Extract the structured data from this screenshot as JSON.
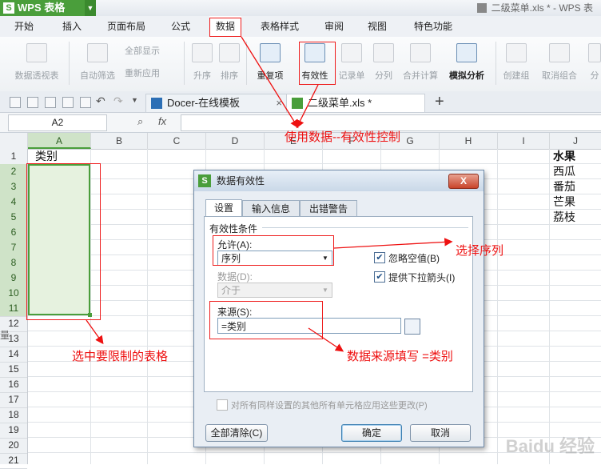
{
  "app": {
    "name": "WPS 表格",
    "logo_letter": "S",
    "document_title": "二级菜单.xls * - WPS 表"
  },
  "menu": [
    "开始",
    "插入",
    "页面布局",
    "公式",
    "数据",
    "表格样式",
    "审阅",
    "视图",
    "特色功能"
  ],
  "ribbon": {
    "pivot": "数据透视表",
    "autofilter": "自动筛选",
    "show_all": "全部显示",
    "reapply": "重新应用",
    "sort_asc": "升序",
    "sort_desc": "排序",
    "duplicates": "重复项",
    "validation": "有效性",
    "record": "记录单",
    "split": "分列",
    "consolidate": "合并计算",
    "what_if": "模拟分析",
    "group": "创建组",
    "ungroup": "取消组合",
    "more": "分"
  },
  "tabs": [
    {
      "label": "Docer-在线模板",
      "active": false
    },
    {
      "label": "二级菜单.xls *",
      "active": true
    }
  ],
  "formula_bar": {
    "name_box": "A2",
    "fx": "fx"
  },
  "grid": {
    "columns": [
      "A",
      "B",
      "C",
      "D",
      "E",
      "F",
      "G",
      "H",
      "I",
      "J"
    ],
    "rows": [
      "1",
      "2",
      "3",
      "4",
      "5",
      "6",
      "7",
      "8",
      "9",
      "10",
      "11",
      "12",
      "13",
      "14",
      "15",
      "16",
      "17",
      "18",
      "19",
      "20",
      "21"
    ],
    "a1": "类别",
    "j_column": [
      "水果",
      "西瓜",
      "番茄",
      "芒果",
      "荔枝"
    ],
    "left_glyph": "量"
  },
  "dialog": {
    "title": "数据有效性",
    "logo_letter": "S",
    "close": "X",
    "tabs": [
      "设置",
      "输入信息",
      "出错警告"
    ],
    "group_label": "有效性条件",
    "allow_label": "允许(A):",
    "allow_value": "序列",
    "data_label": "数据(D):",
    "data_value": "介于",
    "ignore_blank": "忽略空值(B)",
    "ignore_blank_checked": true,
    "dropdown": "提供下拉箭头(I)",
    "dropdown_checked": true,
    "source_label": "来源(S):",
    "source_value": "=类别",
    "apply_all": "对所有同样设置的其他所有单元格应用这些更改(P)",
    "apply_all_checked": false,
    "clear_all": "全部清除(C)",
    "ok": "确定",
    "cancel": "取消"
  },
  "annotations": {
    "validation_note": "使用数据--有效性控制",
    "select_sequence": "选择序列",
    "select_range": "选中要限制的表格",
    "source_note": "数据来源填写  =类别",
    "color": "#ee1111"
  },
  "watermark": "Baidu 经验"
}
